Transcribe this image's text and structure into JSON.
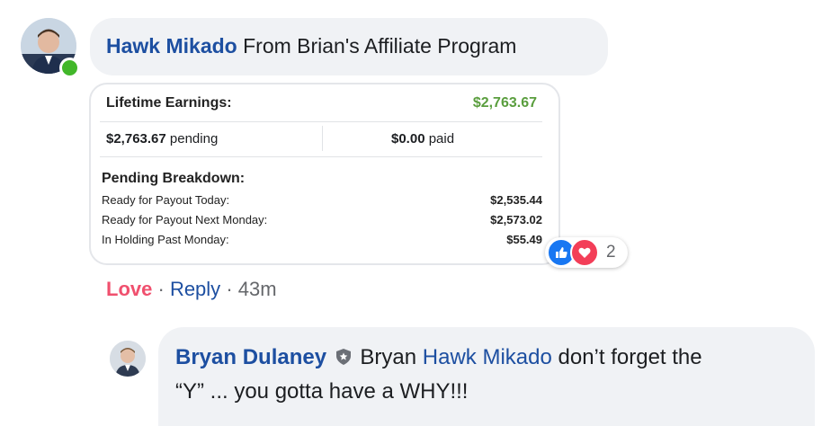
{
  "comment1": {
    "author": "Hawk Mikado",
    "text": "From Brian's Affiliate Program"
  },
  "card": {
    "lifetime_label": "Lifetime Earnings:",
    "lifetime_value": "$2,763.67",
    "pending_amount": "$2,763.67",
    "pending_word": "pending",
    "paid_amount": "$0.00",
    "paid_word": "paid",
    "breakdown_title": "Pending Breakdown:",
    "breakdown": [
      {
        "label": "Ready for Payout Today:",
        "value": "$2,535.44"
      },
      {
        "label": "Ready for Payout Next Monday:",
        "value": "$2,573.02"
      },
      {
        "label": "In Holding Past Monday:",
        "value": "$55.49"
      }
    ]
  },
  "reactions": {
    "count": "2",
    "icons": [
      "like-icon",
      "heart-icon"
    ],
    "like_color": "#1877f2",
    "heart_color": "#f33e58"
  },
  "actions": {
    "love": "Love",
    "dot": "·",
    "reply": "Reply",
    "time": "43m"
  },
  "comment2": {
    "author": "Bryan Dulaney",
    "badge_icon": "shield-badge-icon",
    "text_before": "Bryan",
    "mention": "Hawk Mikado",
    "text_after": "don’t forget the",
    "line2": "“Y” ... you gotta have a WHY!!!"
  }
}
